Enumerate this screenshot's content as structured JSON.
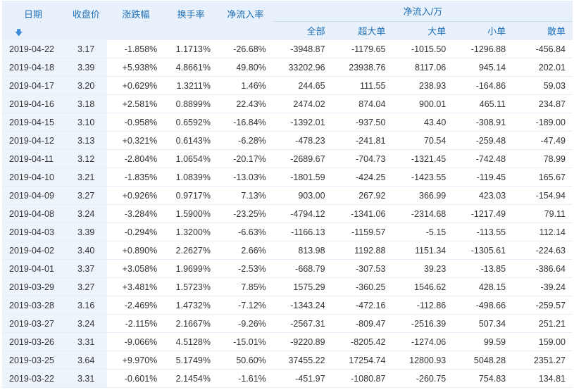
{
  "colors": {
    "header_bg": "#e8f1fb",
    "header_text": "#1f6fb6",
    "up": "#e60000",
    "down": "#2a8a2a"
  },
  "header": {
    "date": "日期",
    "sort_icon": "arrow-down-icon",
    "close": "收盘价",
    "change": "涨跌幅",
    "turnover": "换手率",
    "inflow_ratio": "净流入率",
    "inflow_group": "净流入/万",
    "sub": [
      "全部",
      "超大单",
      "大单",
      "小单",
      "散单"
    ]
  },
  "rows": [
    {
      "date": "2019-04-22",
      "close": "3.17",
      "chg": "-1.858%",
      "turn": "1.1713%",
      "ratio": "-26.68%",
      "all": "-3948.87",
      "xl": "-1179.65",
      "l": "-1015.50",
      "s": "-1296.88",
      "retail": "-456.84"
    },
    {
      "date": "2019-04-18",
      "close": "3.39",
      "chg": "+5.938%",
      "turn": "4.8661%",
      "ratio": "49.80%",
      "all": "33202.96",
      "xl": "23938.76",
      "l": "8117.06",
      "s": "945.14",
      "retail": "202.01"
    },
    {
      "date": "2019-04-17",
      "close": "3.20",
      "chg": "+0.629%",
      "turn": "1.3211%",
      "ratio": "1.46%",
      "all": "244.65",
      "xl": "111.55",
      "l": "238.93",
      "s": "-164.86",
      "retail": "59.03"
    },
    {
      "date": "2019-04-16",
      "close": "3.18",
      "chg": "+2.581%",
      "turn": "0.8899%",
      "ratio": "22.43%",
      "all": "2474.02",
      "xl": "874.04",
      "l": "900.01",
      "s": "465.11",
      "retail": "234.87"
    },
    {
      "date": "2019-04-15",
      "close": "3.10",
      "chg": "-0.958%",
      "turn": "0.6592%",
      "ratio": "-16.84%",
      "all": "-1392.01",
      "xl": "-937.50",
      "l": "43.40",
      "s": "-308.91",
      "retail": "-189.00"
    },
    {
      "date": "2019-04-12",
      "close": "3.13",
      "chg": "+0.321%",
      "turn": "0.6143%",
      "ratio": "-6.28%",
      "all": "-478.23",
      "xl": "-241.81",
      "l": "70.54",
      "s": "-259.48",
      "retail": "-47.49"
    },
    {
      "date": "2019-04-11",
      "close": "3.12",
      "chg": "-2.804%",
      "turn": "1.0654%",
      "ratio": "-20.17%",
      "all": "-2689.67",
      "xl": "-704.73",
      "l": "-1321.45",
      "s": "-742.48",
      "retail": "78.99"
    },
    {
      "date": "2019-04-10",
      "close": "3.21",
      "chg": "-1.835%",
      "turn": "1.0839%",
      "ratio": "-13.03%",
      "all": "-1801.59",
      "xl": "-424.25",
      "l": "-1423.55",
      "s": "-119.45",
      "retail": "165.67"
    },
    {
      "date": "2019-04-09",
      "close": "3.27",
      "chg": "+0.926%",
      "turn": "0.9717%",
      "ratio": "7.13%",
      "all": "903.00",
      "xl": "267.92",
      "l": "366.99",
      "s": "423.03",
      "retail": "-154.94"
    },
    {
      "date": "2019-04-08",
      "close": "3.24",
      "chg": "-3.284%",
      "turn": "1.5900%",
      "ratio": "-23.25%",
      "all": "-4794.12",
      "xl": "-1341.06",
      "l": "-2314.68",
      "s": "-1217.49",
      "retail": "79.11"
    },
    {
      "date": "2019-04-03",
      "close": "3.39",
      "chg": "-0.294%",
      "turn": "1.3200%",
      "ratio": "-6.63%",
      "all": "-1166.13",
      "xl": "-1159.57",
      "l": "-5.15",
      "s": "-113.55",
      "retail": "112.14"
    },
    {
      "date": "2019-04-02",
      "close": "3.40",
      "chg": "+0.890%",
      "turn": "2.2627%",
      "ratio": "2.66%",
      "all": "813.98",
      "xl": "1192.88",
      "l": "1151.34",
      "s": "-1305.61",
      "retail": "-224.63"
    },
    {
      "date": "2019-04-01",
      "close": "3.37",
      "chg": "+3.058%",
      "turn": "1.9699%",
      "ratio": "-2.53%",
      "all": "-668.79",
      "xl": "-307.53",
      "l": "39.23",
      "s": "-13.85",
      "retail": "-386.64"
    },
    {
      "date": "2019-03-29",
      "close": "3.27",
      "chg": "+3.481%",
      "turn": "1.5723%",
      "ratio": "7.85%",
      "all": "1575.29",
      "xl": "-360.25",
      "l": "1546.62",
      "s": "428.15",
      "retail": "-39.24"
    },
    {
      "date": "2019-03-28",
      "close": "3.16",
      "chg": "-2.469%",
      "turn": "1.4732%",
      "ratio": "-7.12%",
      "all": "-1343.24",
      "xl": "-472.16",
      "l": "-112.86",
      "s": "-498.66",
      "retail": "-259.57"
    },
    {
      "date": "2019-03-27",
      "close": "3.24",
      "chg": "-2.115%",
      "turn": "2.1667%",
      "ratio": "-9.26%",
      "all": "-2567.31",
      "xl": "-809.47",
      "l": "-2516.39",
      "s": "507.34",
      "retail": "251.21"
    },
    {
      "date": "2019-03-26",
      "close": "3.31",
      "chg": "-9.066%",
      "turn": "4.5128%",
      "ratio": "-15.01%",
      "all": "-9220.89",
      "xl": "-8205.42",
      "l": "-1274.06",
      "s": "99.59",
      "retail": "159.00"
    },
    {
      "date": "2019-03-25",
      "close": "3.64",
      "chg": "+9.970%",
      "turn": "5.1749%",
      "ratio": "50.60%",
      "all": "37455.22",
      "xl": "17254.74",
      "l": "12800.93",
      "s": "5048.28",
      "retail": "2351.27"
    },
    {
      "date": "2019-03-22",
      "close": "3.31",
      "chg": "-0.601%",
      "turn": "2.1454%",
      "ratio": "-1.61%",
      "all": "-451.97",
      "xl": "-1080.87",
      "l": "-260.75",
      "s": "754.83",
      "retail": "134.81"
    }
  ]
}
